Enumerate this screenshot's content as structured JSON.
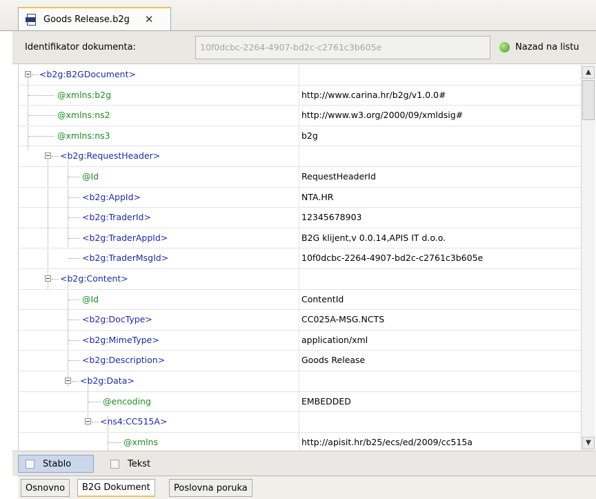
{
  "tab": {
    "title": "Goods Release.b2g",
    "close": "✕",
    "icon": "b2g-file-icon"
  },
  "infobar": {
    "label": "Identifikator dokumenta:",
    "doc_id": "10f0dcbc-2264-4907-bd2c-c2761c3b605e",
    "back_label": "Nazad na listu"
  },
  "tree": {
    "rows": [
      {
        "name": "<b2g:B2GDocument>",
        "value": "",
        "kind": "el"
      },
      {
        "name": "@xmlns:b2g",
        "value": "http://www.carina.hr/b2g/v1.0.0#",
        "kind": "at"
      },
      {
        "name": "@xmlns:ns2",
        "value": "http://www.w3.org/2000/09/xmldsig#",
        "kind": "at"
      },
      {
        "name": "@xmlns:ns3",
        "value": "b2g",
        "kind": "at"
      },
      {
        "name": "<b2g:RequestHeader>",
        "value": "",
        "kind": "el"
      },
      {
        "name": "@Id",
        "value": "RequestHeaderId",
        "kind": "at"
      },
      {
        "name": "<b2g:AppId>",
        "value": "NTA.HR",
        "kind": "el"
      },
      {
        "name": "<b2g:TraderId>",
        "value": "12345678903",
        "kind": "el"
      },
      {
        "name": "<b2g:TraderAppId>",
        "value": "B2G klijent,v 0.0.14,APIS IT d.o.o.",
        "kind": "el"
      },
      {
        "name": "<b2g:TraderMsgId>",
        "value": "10f0dcbc-2264-4907-bd2c-c2761c3b605e",
        "kind": "el"
      },
      {
        "name": "<b2g:Content>",
        "value": "",
        "kind": "el"
      },
      {
        "name": "@Id",
        "value": "ContentId",
        "kind": "at"
      },
      {
        "name": "<b2g:DocType>",
        "value": "CC025A-MSG.NCTS",
        "kind": "el"
      },
      {
        "name": "<b2g:MimeType>",
        "value": "application/xml",
        "kind": "el"
      },
      {
        "name": "<b2g:Description>",
        "value": "Goods Release",
        "kind": "el"
      },
      {
        "name": "<b2g:Data>",
        "value": "",
        "kind": "el"
      },
      {
        "name": "@encoding",
        "value": "EMBEDDED",
        "kind": "at"
      },
      {
        "name": "<ns4:CC515A>",
        "value": "",
        "kind": "el"
      },
      {
        "name": "@xmlns",
        "value": "http://apisit.hr/b25/ecs/ed/2009/cc515a",
        "kind": "at"
      }
    ]
  },
  "viewtabs": {
    "tree": "Stablo",
    "text": "Tekst"
  },
  "bottomtabs": {
    "basic": "Osnovno",
    "b2g": "B2G Dokument",
    "business": "Poslovna poruka"
  },
  "colors": {
    "element": "#1f2aa0",
    "attribute": "#1e8a22",
    "active_tab_accent": "#f2c14e"
  }
}
